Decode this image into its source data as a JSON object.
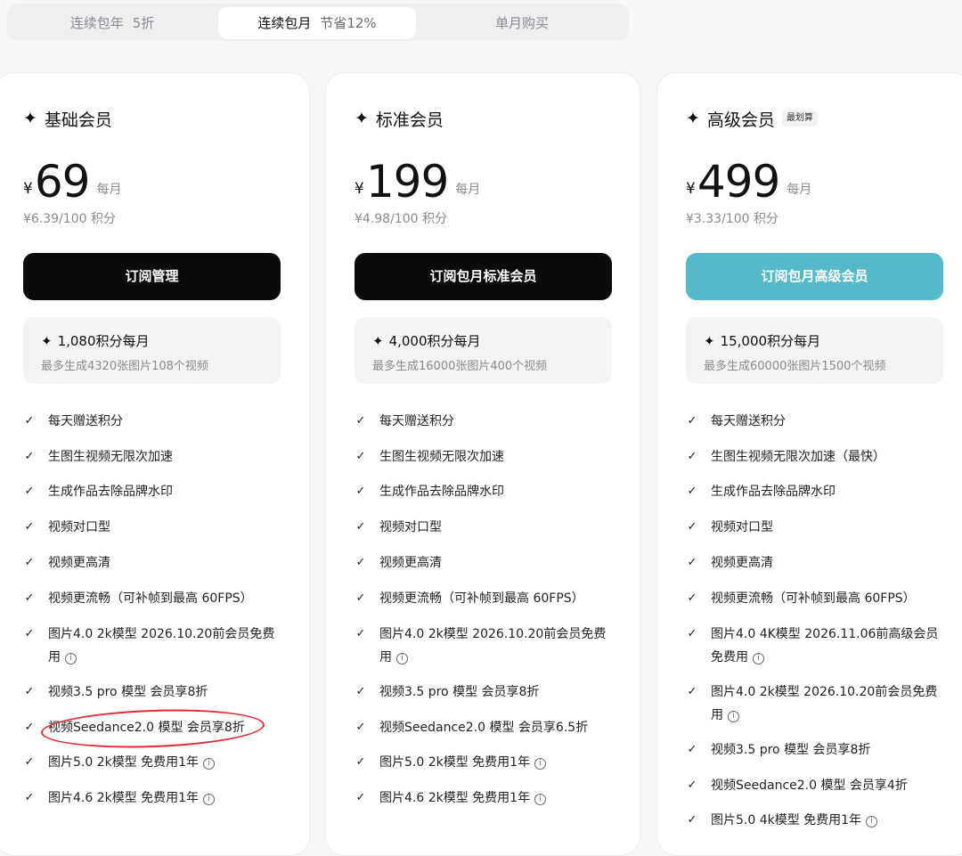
{
  "tabs": [
    {
      "label": "连续包年",
      "badge": "5折"
    },
    {
      "label": "连续包月",
      "badge": "节省12%"
    },
    {
      "label": "单月购买",
      "badge": ""
    }
  ],
  "plans": [
    {
      "name": "基础会员",
      "tag": "",
      "currency": "¥",
      "price": "69",
      "period": "每月",
      "unit_price": "¥6.39/100 积分",
      "cta": "订阅管理",
      "credits_title": "1,080积分每月",
      "credits_sub": "最多生成4320张图片108个视频",
      "features": [
        "每天赠送积分",
        "生图生视频无限次加速",
        "生成作品去除品牌水印",
        "视频对口型",
        "视频更高清",
        "视频更流畅（可补帧到最高 60FPS）",
        "图片4.0 2k模型 2026.10.20前会员免费",
        "用",
        "视频3.5 pro 模型 会员享8折",
        "视频Seedance2.0 模型 会员享8折",
        "图片5.0 2k模型 免费用1年",
        "图片4.6 2k模型 免费用1年"
      ]
    },
    {
      "name": "标准会员",
      "tag": "",
      "currency": "¥",
      "price": "199",
      "period": "每月",
      "unit_price": "¥4.98/100 积分",
      "cta": "订阅包月标准会员",
      "credits_title": "4,000积分每月",
      "credits_sub": "最多生成16000张图片400个视频",
      "features": [
        "每天赠送积分",
        "生图生视频无限次加速",
        "生成作品去除品牌水印",
        "视频对口型",
        "视频更高清",
        "视频更流畅（可补帧到最高 60FPS）",
        "图片4.0 2k模型 2026.10.20前会员免费",
        "用",
        "视频3.5 pro 模型 会员享8折",
        "视频Seedance2.0 模型 会员享6.5折",
        "图片5.0 2k模型 免费用1年",
        "图片4.6 2k模型 免费用1年"
      ]
    },
    {
      "name": "高级会员",
      "tag": "最划算",
      "currency": "¥",
      "price": "499",
      "period": "每月",
      "unit_price": "¥3.33/100 积分",
      "cta": "订阅包月高级会员",
      "credits_title": "15,000积分每月",
      "credits_sub": "最多生成60000张图片1500个视频",
      "features": [
        "每天赠送积分",
        "生图生视频无限次加速（最快）",
        "生成作品去除品牌水印",
        "视频对口型",
        "视频更高清",
        "视频更流畅（可补帧到最高 60FPS）",
        "图片4.0 4K模型 2026.11.06前高级会员",
        "免费用",
        "图片4.0 2k模型 2026.10.20前会员免费",
        "用",
        "视频3.5 pro 模型 会员享8折",
        "视频Seedance2.0 模型 会员享4折",
        "图片5.0 4k模型 免费用1年"
      ]
    }
  ],
  "icons": {
    "spark": "✦",
    "check": "✓",
    "info": "i"
  },
  "colors": {
    "cta_dark": "#0b0b0d",
    "cta_teal": "#56b9c9",
    "highlight_ring": "#e12b36"
  }
}
